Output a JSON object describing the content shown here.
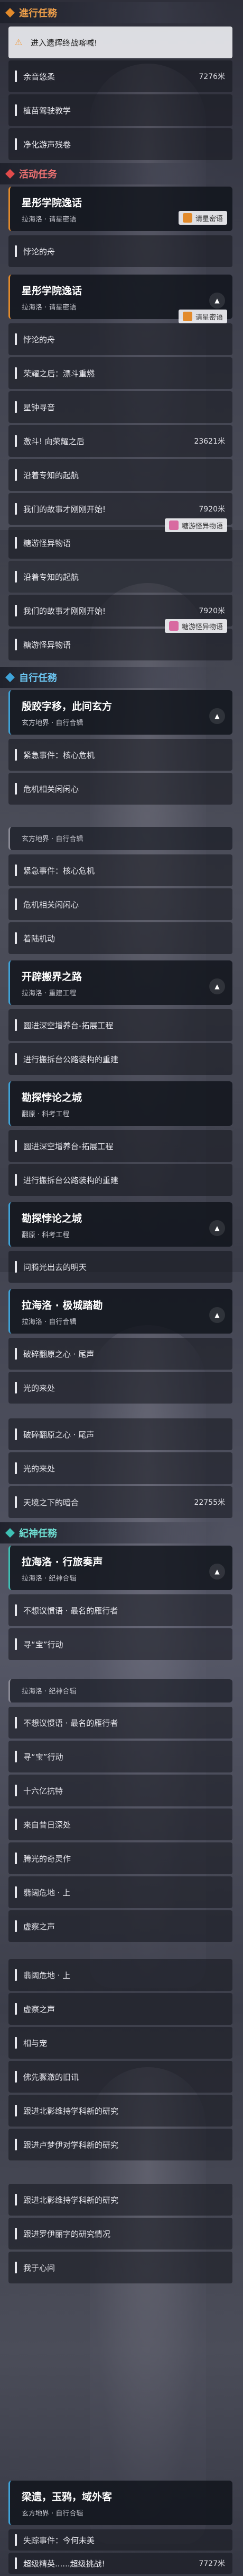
{
  "sections": {
    "s1": "進行任務",
    "s2": "活动任务",
    "s3": "自行任務",
    "s4": "紀神任務"
  },
  "rows": {
    "r1": "进入遗辉终战喀喊!",
    "r2": "余音悠柔",
    "r2d": "7276米",
    "r3": "植苗驾驶教学",
    "r4": "净化游声残卷",
    "r5": "悖论的舟",
    "r6": "悖论的舟",
    "r7": "荣耀之后：漂斗重燃",
    "r8": "星钟寻音",
    "r9": "激斗! 向荣耀之后",
    "r9d": "23621米",
    "r10": "沿着专知的起航",
    "r11": "我们的故事才刚刚开始!",
    "r11d": "7920米",
    "r12": "糖游怪异物语",
    "r13": "沿着专知的起航",
    "r14": "我们的故事才刚刚开始!",
    "r14d": "7920米",
    "r15": "糖游怪异物语",
    "r16": "紧急事件：核心危机",
    "r17": "危机相关闲闲心",
    "r18": "紧急事件：核心危机",
    "r19": "危机相关闲闲心",
    "r20": "着陆机动",
    "r21": "圆进深空增养台-拓展工程",
    "r22": "进行搬拆台公路装构的重建",
    "r23": "圆进深空增养台-拓展工程",
    "r24": "进行搬拆台公路装构的重建",
    "r25": "问腾光出去的明天",
    "r26": "破碎翻原之心 · 尾声",
    "r27": "光的来处",
    "r28": "破碎翻原之心 · 尾声",
    "r29": "光的来处",
    "r30": "天境之下的暗合",
    "r30d": "22755米",
    "r31": "不想议惯语 · 最名的雁行者",
    "r32": "寻“宝”行动",
    "r33": "不想议惯语 · 最名的雁行者",
    "r34": "寻“宝”行动",
    "r35": "十六亿抗特",
    "r36": "来自昔日深处",
    "r37": "腾光的奇灵作",
    "r38": "翡阔危地 · 上",
    "r39": "虚察之声",
    "r40": "翡阔危地 · 上",
    "r41": "虚察之声",
    "r42": "相与宠",
    "r43": "佛先骤澈的旧讯",
    "r44": "跟进北影维持学科新的研究",
    "r45": "跟进卢梦伊对学科新的研究",
    "r46": "跟进北影维持学科新的研究",
    "r47": "跟进罗伊丽字的研究情况",
    "r48": "我于心间",
    "r49": "失踪事件：今何未美",
    "r50": "超级精英......超级挑战!",
    "r50d": "7727米"
  },
  "cards": {
    "c1": {
      "title": "星彤学院逸话",
      "sub": "拉海洛 · 请星密语"
    },
    "c2": {
      "title": "星彤学院逸话",
      "sub": "拉海洛 · 请星密语"
    },
    "c3": {
      "title": "殷跤字移，此间玄方",
      "sub": "玄方地界 · 自行合辑"
    },
    "c4": {
      "title": "玄方地界 · 自行合辑",
      "sub": ""
    },
    "c5": {
      "title": "开辟搬界之路",
      "sub": "拉海洛 · 重建工程"
    },
    "c6": {
      "title": "勘探悖论之城",
      "sub": "翻原 · 科考工程"
    },
    "c7": {
      "title": "勘探悖论之城",
      "sub": "翻原 · 科考工程"
    },
    "c8": {
      "title": "拉海洛 · 极城踏勘",
      "sub": "拉海洛 · 自行合辑"
    },
    "c9": {
      "title": "拉海洛 · 行旅奏声",
      "sub": "拉海洛 · 纪神合辑"
    },
    "c10": {
      "title": "拉海洛 · 纪神合辑",
      "sub": ""
    },
    "c11": {
      "title": "梁遗，玉鸦，域外客",
      "sub": "玄方地界 · 自行合辑"
    }
  },
  "tags": {
    "t1": "请星密语",
    "t2": "请星密语",
    "t3": "糖游怪异物语",
    "t4": "糖游怪异物语"
  },
  "colors": {
    "orange": "#e28a2b",
    "blue": "#3ea3d9",
    "red": "#e14b4b",
    "teal": "#3ec0b4"
  }
}
